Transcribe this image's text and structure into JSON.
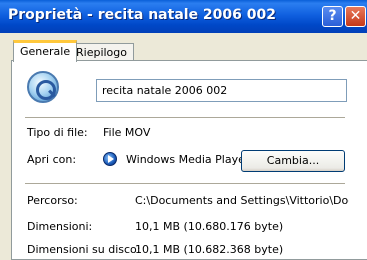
{
  "window": {
    "title": "Proprietà - recita natale 2006 002",
    "help_label": "?",
    "close_label": "✕"
  },
  "tabs": [
    {
      "label": "Generale"
    },
    {
      "label": "Riepilogo"
    }
  ],
  "general": {
    "file_icon": "quicktime-icon",
    "file_name": "recita natale 2006 002",
    "file_type_label": "Tipo di file:",
    "file_type_value": "File MOV",
    "open_with_label": "Apri con:",
    "open_with_icon": "windows-media-player-icon",
    "open_with_value": "Windows Media Player",
    "change_button": "Cambia...",
    "path_label": "Percorso:",
    "path_value": "C:\\Documents and Settings\\Vittorio\\Docume",
    "size_label": "Dimensioni:",
    "size_value": "10,1 MB (10.680.176 byte)",
    "size_on_disk_label": "Dimensioni su disco:",
    "size_on_disk_value": "10,1 MB (10.682.368 byte)"
  }
}
